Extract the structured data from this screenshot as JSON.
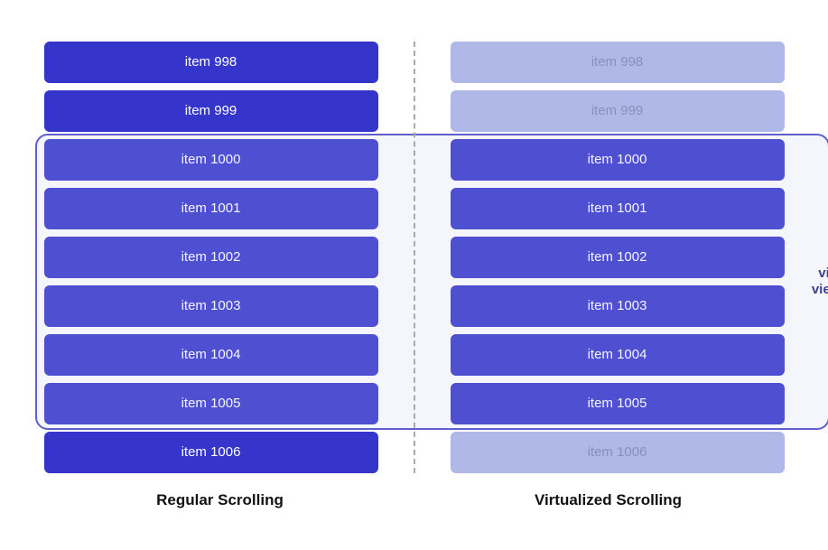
{
  "diagram": {
    "items": [
      {
        "id": "998",
        "label": "item 998"
      },
      {
        "id": "999",
        "label": "item 999"
      },
      {
        "id": "1000",
        "label": "item 1000"
      },
      {
        "id": "1001",
        "label": "item 1001"
      },
      {
        "id": "1002",
        "label": "item 1002"
      },
      {
        "id": "1003",
        "label": "item 1003"
      },
      {
        "id": "1004",
        "label": "item 1004"
      },
      {
        "id": "1005",
        "label": "item 1005"
      },
      {
        "id": "1006",
        "label": "item 1006"
      }
    ],
    "viewport_start": 2,
    "viewport_end": 7,
    "left_label": "Regular Scrolling",
    "right_label": "Virtualized Scrolling",
    "arrow_label": "visible\nviewport",
    "colors": {
      "active": "#3535cc",
      "faded": "#b0b8e8",
      "faded_text": "#8890bb",
      "border": "#6060cc",
      "arrow": "#22227a"
    }
  }
}
